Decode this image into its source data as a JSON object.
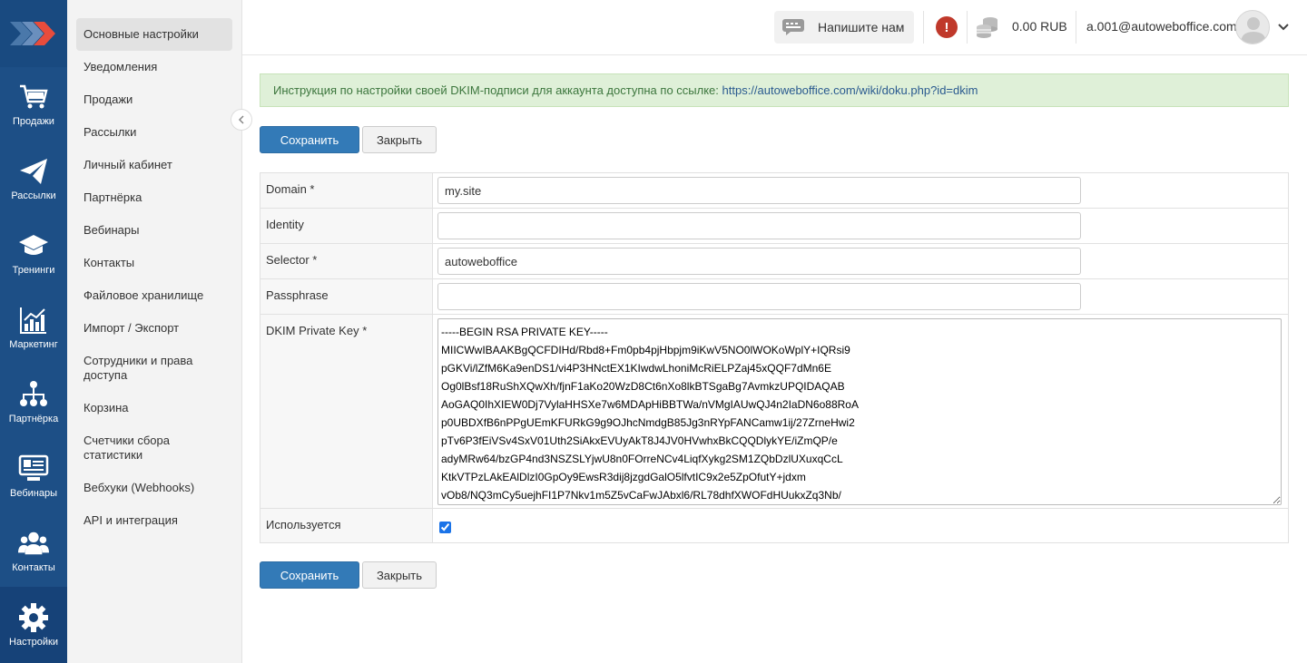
{
  "rail": {
    "items": [
      {
        "label": "Продажи",
        "icon": "cart-icon"
      },
      {
        "label": "Рассылки",
        "icon": "paper-plane-icon"
      },
      {
        "label": "Тренинги",
        "icon": "graduation-cap-icon"
      },
      {
        "label": "Маркетинг",
        "icon": "bar-chart-icon"
      },
      {
        "label": "Партнёрка",
        "icon": "network-icon"
      },
      {
        "label": "Вебинары",
        "icon": "webinar-screen-icon"
      },
      {
        "label": "Контакты",
        "icon": "users-icon"
      }
    ],
    "active": {
      "label": "Настройки",
      "icon": "gear-icon"
    }
  },
  "menu": {
    "items": [
      "Основные настройки",
      "Уведомления",
      "Продажи",
      "Рассылки",
      "Личный кабинет",
      "Партнёрка",
      "Вебинары",
      "Контакты",
      "Файловое хранилище",
      "Импорт / Экспорт",
      "Сотрудники и права доступа",
      "Корзина",
      "Счетчики сбора статистики",
      "Вебхуки (Webhooks)",
      "API и интеграция"
    ]
  },
  "header": {
    "write_us": "Напишите нам",
    "balance": "0.00 RUB",
    "user_email": "a.001@autoweboffice.com"
  },
  "notice": {
    "text": "Инструкция по настройки своей DKIM-подписи для аккаунта доступна по ссылке: ",
    "link": "https://autoweboffice.com/wiki/doku.php?id=dkim"
  },
  "buttons": {
    "save": "Сохранить",
    "close": "Закрыть"
  },
  "form": {
    "domain_label": "Domain *",
    "domain_value": "my.site",
    "identity_label": "Identity",
    "identity_value": "",
    "selector_label": "Selector *",
    "selector_value": "autoweboffice",
    "passphrase_label": "Passphrase",
    "passphrase_value": "",
    "dkim_label": "DKIM Private Key *",
    "dkim_value": "-----BEGIN RSA PRIVATE KEY-----\nMIICWwIBAAKBgQCFDIHd/Rbd8+Fm0pb4pjHbpjm9iKwV5NO0lWOKoWplY+IQRsi9\npGKVi/lZfM6Ka9enDS1/vi4P3HNctEX1KIwdwLhoniMcRiELPZaj45xQQF7dMn6E\nOg0lBsf18RuShXQwXh/fjnF1aKo20WzD8Ct6nXo8lkBTSgaBg7AvmkzUPQIDAQAB\nAoGAQ0IhXIEW0Dj7VylaHHSXe7w6MDApHiBBTWa/nVMgIAUwQJ4n2IaDN6o88RoA\np0UBDXfB6nPPgUEmKFURkG9g9OJhcNmdgB85Jg3nRYpFANCamw1ij/27ZrneHwi2\npTv6P3fEiVSv4SxV01Uth2SiAkxEVUyAkT8J4JV0HVwhxBkCQQDlykYE/iZmQP/e\nadyMRw64/bzGP4nd3NSZSLYjwU8n0FOrreNCv4LiqfXykg2SM1ZQbDzlUXuxqCcL\nKtkVTPzLAkEAlDlzI0GpOy9EwsR3dij8jzgdGalO5lfvtIC9x2e5ZpOfutY+jdxm\nvOb8/NQ3mCy5uejhFI1P7Nkv1m5Z5vCaFwJAbxl6/RL78dhfXWOFdHUukxZq3Nb/",
    "used_label": "Используется",
    "used_checked": true
  }
}
